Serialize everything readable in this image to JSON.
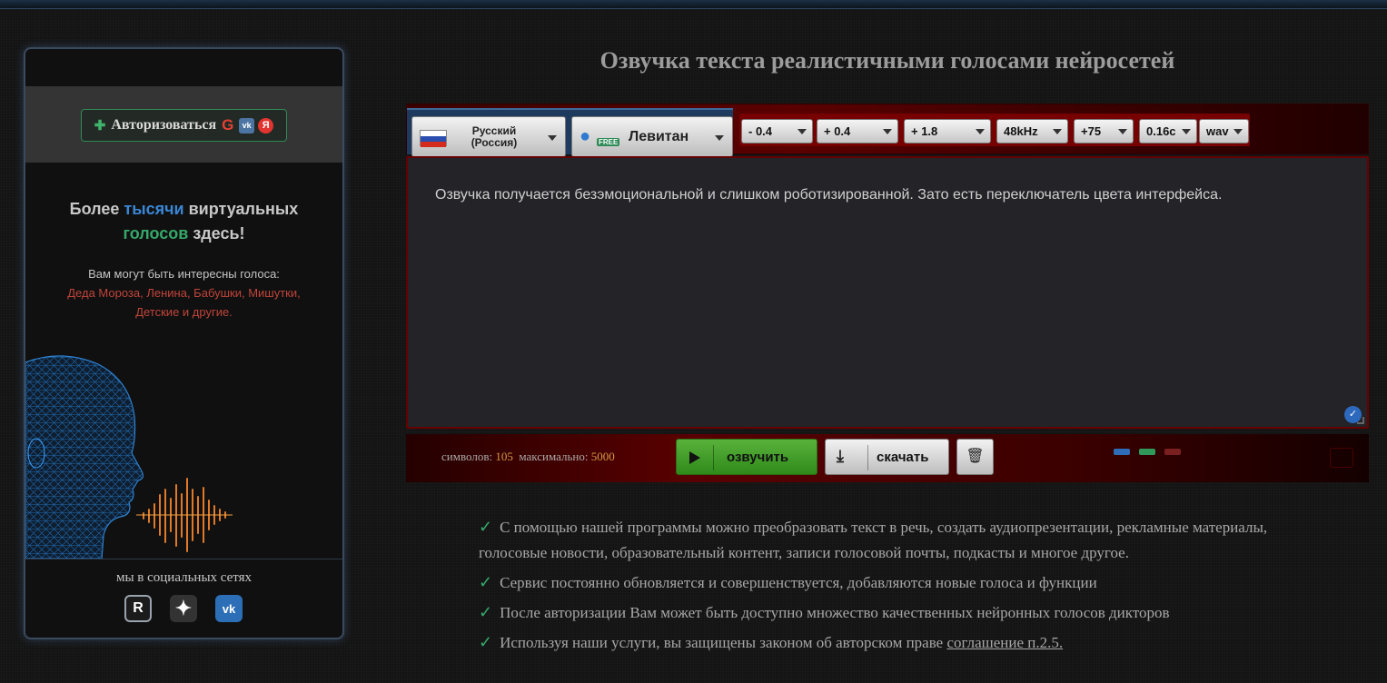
{
  "sidebar": {
    "auth_label": "Авторизоваться",
    "promo_line1_a": "Более ",
    "promo_line1_b": "тысячи",
    "promo_line1_c": " виртуальных",
    "promo_line2_a": "голосов",
    "promo_line2_b": " здесь!",
    "promo_sub": "Вам могут быть интересны голоса:",
    "promo_voices_1": "Деда Мороза, Ленина, Бабушки, Мишутки,",
    "promo_voices_2": "Детские и другие.",
    "social_title": "мы в социальных сетях",
    "social": {
      "r": "R",
      "vk": "vk"
    }
  },
  "header": {
    "title": "Озвучка текста реалистичными голосами нейросетей"
  },
  "toolbar": {
    "lang_line1": "Русский",
    "lang_line2": "(Россия)",
    "free_badge": "FREE",
    "voice": "Левитан",
    "params": [
      "- 0.4",
      "+ 0.4",
      "+ 1.8",
      "48kHz",
      "+75",
      "0.16с",
      "wav"
    ]
  },
  "editor": {
    "text": "Озвучка получается безэмоциональной и слишком роботизированной. Зато есть переключатель цвета интерфейса."
  },
  "actions": {
    "symbols_label": "символов:",
    "symbols_value": "105",
    "max_label": "максимально:",
    "max_value": "5000",
    "speak_label": "озвучить",
    "download_label": "скачать"
  },
  "themes": {
    "colors": [
      "#2f6db8",
      "#2f9a5a",
      "#7a2020"
    ]
  },
  "features": {
    "f1": "С помощью нашей программы можно преобразовать текст в речь, создать аудиопрезентации, рекламные материалы, голосовые новости, образовательный контент, записи голосовой почты, подкасты и многое другое.",
    "f2": "Сервис постоянно обновляется и совершенствуется, добавляются новые голоса и функции",
    "f3": "После авторизации Вам может быть доступно множество качественных нейронных голосов дикторов",
    "f4": "Используя наши услуги, вы защищены законом об авторском праве ",
    "f4_link": "соглашение п.2.5."
  },
  "colors": {
    "accent_green": "#35a86a",
    "accent_blue": "#3a86d4",
    "dark_red": "#5a0000"
  }
}
